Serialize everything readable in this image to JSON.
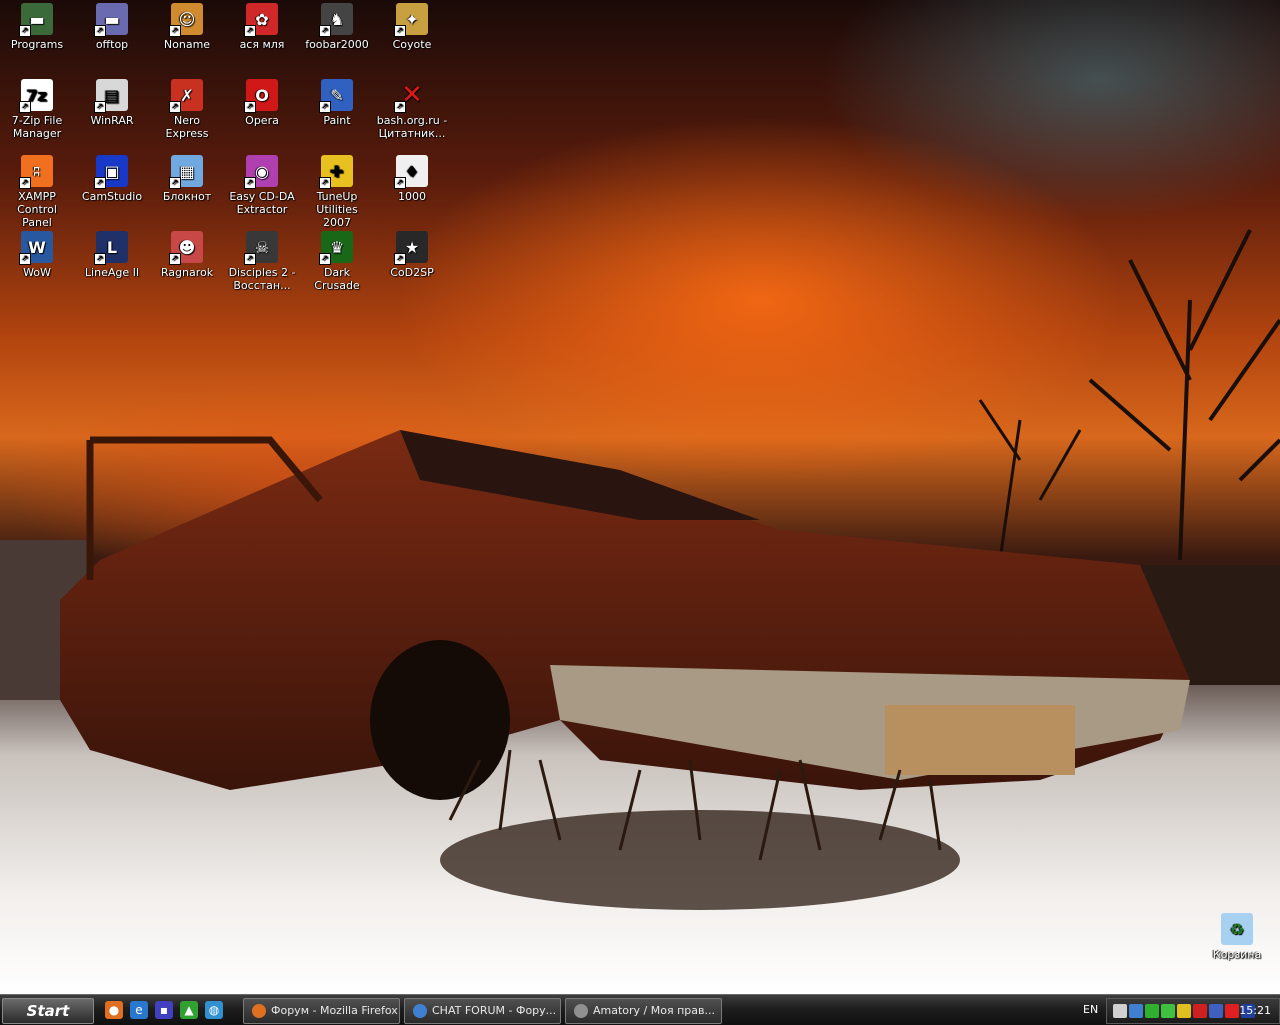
{
  "desktop": {
    "icons": [
      {
        "label": "Programs",
        "icon": "drive-icon",
        "color": "#3a6a3a",
        "glyph": "▬"
      },
      {
        "label": "offtop",
        "icon": "drive-icon",
        "color": "#6a6ab0",
        "glyph": "▬"
      },
      {
        "label": "Noname",
        "icon": "users-icon",
        "color": "#d08a30",
        "glyph": "☺"
      },
      {
        "label": "ася мля",
        "icon": "app-icon",
        "color": "#d02828",
        "glyph": "✿"
      },
      {
        "label": "foobar2000",
        "icon": "foobar-icon",
        "color": "#444444",
        "glyph": "♞"
      },
      {
        "label": "Coyote",
        "icon": "coyote-icon",
        "color": "#c8a040",
        "glyph": "✦"
      },
      {
        "label": "7-Zip File Manager",
        "icon": "7zip-icon",
        "color": "#ffffff",
        "glyph": "7z"
      },
      {
        "label": "WinRAR",
        "icon": "winrar-icon",
        "color": "#d8d8d8",
        "glyph": "▤"
      },
      {
        "label": "Nero Express",
        "icon": "nero-icon",
        "color": "#c83020",
        "glyph": "✗"
      },
      {
        "label": "Opera",
        "icon": "opera-icon",
        "color": "#d01818",
        "glyph": "O"
      },
      {
        "label": "Paint",
        "icon": "paint-icon",
        "color": "#3060c0",
        "glyph": "✎"
      },
      {
        "label": "bash.org.ru - Цитатник...",
        "icon": "broken-link-icon",
        "color": "transparent",
        "glyph": "✕"
      },
      {
        "label": "XAMPP Control Panel",
        "icon": "xampp-icon",
        "color": "#f07020",
        "glyph": "ʭ"
      },
      {
        "label": "CamStudio",
        "icon": "camstudio-icon",
        "color": "#1838c8",
        "glyph": "▣"
      },
      {
        "label": "Блокнот",
        "icon": "notepad-icon",
        "color": "#70a8e0",
        "glyph": "▦"
      },
      {
        "label": "Easy CD-DA Extractor",
        "icon": "cd-icon",
        "color": "#b040b0",
        "glyph": "◉"
      },
      {
        "label": "TuneUp Utilities 2007",
        "icon": "tuneup-icon",
        "color": "#e8c020",
        "glyph": "✚"
      },
      {
        "label": "1000",
        "icon": "cards-icon",
        "color": "#f0f0f0",
        "glyph": "♦"
      },
      {
        "label": "WoW",
        "icon": "wow-icon",
        "color": "#2858a0",
        "glyph": "W"
      },
      {
        "label": "LineAge II",
        "icon": "lineage-icon",
        "color": "#203068",
        "glyph": "L"
      },
      {
        "label": "Ragnarok",
        "icon": "ragnarok-icon",
        "color": "#c84848",
        "glyph": "☻"
      },
      {
        "label": "Disciples 2 - Восстан...",
        "icon": "disciples-icon",
        "color": "#383838",
        "glyph": "☠"
      },
      {
        "label": "Dark Crusade",
        "icon": "dark-crusade-icon",
        "color": "#186818",
        "glyph": "♛"
      },
      {
        "label": "CoD2SP",
        "icon": "cod2-icon",
        "color": "#282828",
        "glyph": "★"
      }
    ],
    "recycle_bin": {
      "label": "Корзина",
      "icon": "recycle-bin-icon"
    }
  },
  "taskbar": {
    "start_label": "Start",
    "quick_launch": [
      {
        "icon": "firefox-icon",
        "color": "#e07020",
        "glyph": "●"
      },
      {
        "icon": "ie-icon",
        "color": "#2878d0",
        "glyph": "e"
      },
      {
        "icon": "save-icon",
        "color": "#4040c0",
        "glyph": "▪"
      },
      {
        "icon": "triangle-icon",
        "color": "#30a030",
        "glyph": "▲"
      },
      {
        "icon": "globe-icon",
        "color": "#3090d0",
        "glyph": "◍"
      }
    ],
    "tasks": [
      {
        "label": "Форум - Mozilla Firefox",
        "icon": "firefox-icon",
        "color": "#e07020"
      },
      {
        "label": "CHAT FORUM - Фору...",
        "icon": "document-icon",
        "color": "#4080d0"
      },
      {
        "label": "Amatory / Моя прав...",
        "icon": "alien-icon",
        "color": "#909090"
      }
    ],
    "language": "EN",
    "tray_icons": [
      {
        "icon": "network-icon",
        "color": "#d0d0d0"
      },
      {
        "icon": "monitor-icon",
        "color": "#4080d0"
      },
      {
        "icon": "chat-icon",
        "color": "#30b030"
      },
      {
        "icon": "icq-icon",
        "color": "#40c040"
      },
      {
        "icon": "flower-icon",
        "color": "#e0c020"
      },
      {
        "icon": "alert-icon",
        "color": "#d02020"
      },
      {
        "icon": "display-icon",
        "color": "#4060c0"
      },
      {
        "icon": "error-icon",
        "color": "#e02020"
      },
      {
        "icon": "3d-icon",
        "color": "#2040a0"
      }
    ],
    "clock": "15:21"
  }
}
